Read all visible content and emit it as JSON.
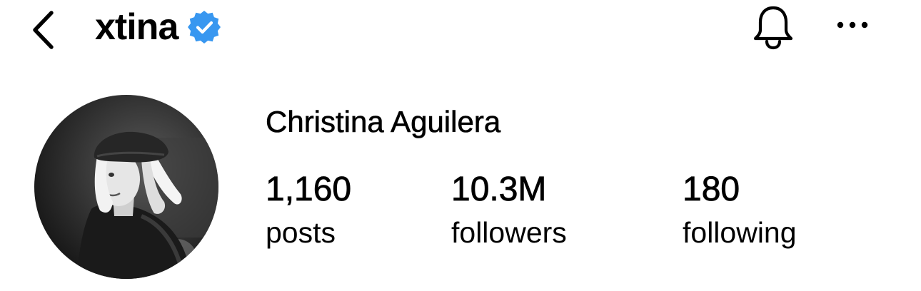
{
  "header": {
    "username": "xtina",
    "verified": true,
    "icons": {
      "back": "chevron-left-icon",
      "verified": "verified-badge-icon",
      "notifications": "bell-icon",
      "more": "ellipsis-icon"
    },
    "verified_color": "#3897f0"
  },
  "profile": {
    "full_name": "Christina Aguilera",
    "stats": [
      {
        "value": "1,160",
        "label": "posts"
      },
      {
        "value": "10.3M",
        "label": "followers"
      },
      {
        "value": "180",
        "label": "following"
      }
    ]
  }
}
